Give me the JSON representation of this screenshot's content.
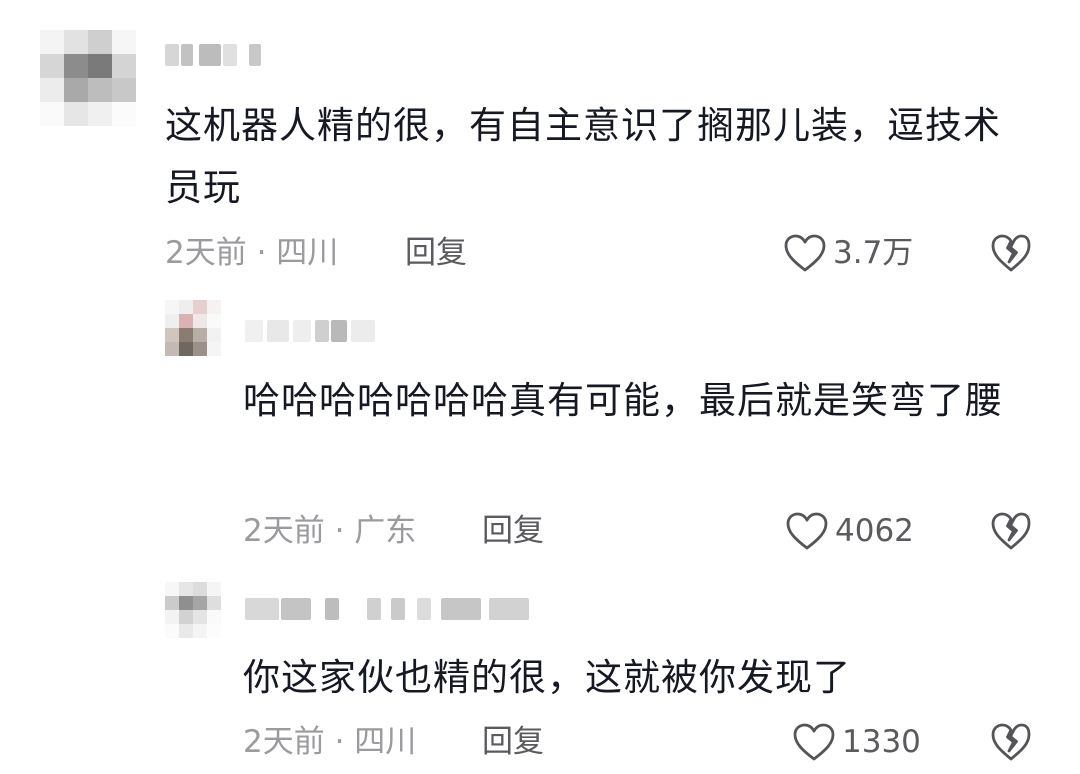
{
  "comments": [
    {
      "text": "这机器人精的很，有自主意识了搁那儿装，逗技术员玩",
      "time": "2天前",
      "location": "四川",
      "reply_label": "回复",
      "likes": "3.7万"
    },
    {
      "text": "哈哈哈哈哈哈哈真有可能，最后就是笑弯了腰",
      "time": "2天前",
      "location": "广东",
      "reply_label": "回复",
      "likes": "4062"
    },
    {
      "text": "你这家伙也精的很，这就被你发现了",
      "time": "2天前",
      "location": "四川",
      "reply_label": "回复",
      "likes": "1330"
    }
  ],
  "meta_separator": " · ",
  "icons": {
    "like": "heart-outline-icon",
    "dislike": "broken-heart-icon"
  },
  "colors": {
    "text": "#161823",
    "meta": "#9a9a9f",
    "action": "#5a5a5f"
  }
}
